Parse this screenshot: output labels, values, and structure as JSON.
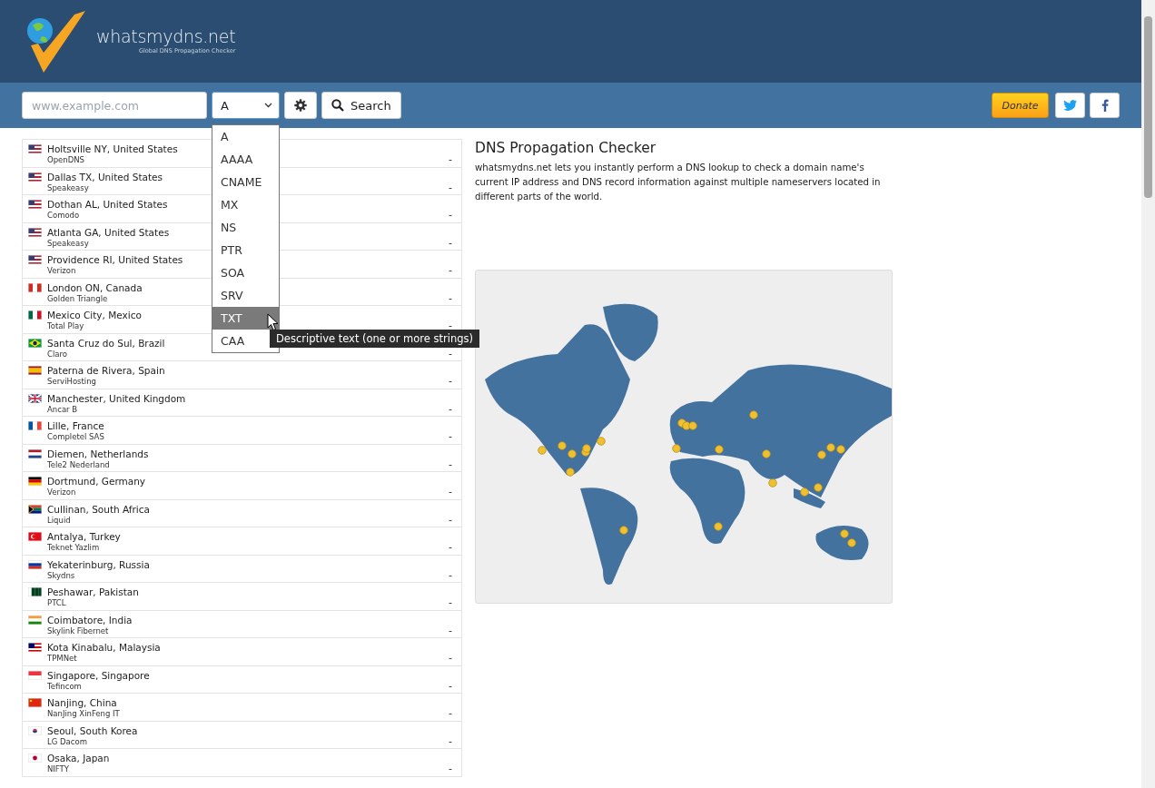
{
  "logo": {
    "name": "whatsmydns.net",
    "tagline": "Global DNS Propagation Checker"
  },
  "search": {
    "placeholder": "www.example.com",
    "record_type": "A",
    "button": "Search"
  },
  "record_menu": {
    "open": true,
    "options": [
      {
        "label": "A",
        "selected": false
      },
      {
        "label": "AAAA",
        "selected": false
      },
      {
        "label": "CNAME",
        "selected": false
      },
      {
        "label": "MX",
        "selected": false
      },
      {
        "label": "NS",
        "selected": false
      },
      {
        "label": "PTR",
        "selected": false
      },
      {
        "label": "SOA",
        "selected": false
      },
      {
        "label": "SRV",
        "selected": false
      },
      {
        "label": "TXT",
        "selected": true
      },
      {
        "label": "CAA",
        "selected": false
      }
    ],
    "tooltip": "Descriptive text (one or more strings)"
  },
  "donate": "Donate",
  "servers": [
    {
      "location": "Holtsville NY, United States",
      "provider": "OpenDNS",
      "result": "-",
      "kind": "us"
    },
    {
      "location": "Dallas TX, United States",
      "provider": "Speakeasy",
      "result": "-",
      "kind": "us"
    },
    {
      "location": "Dothan AL, United States",
      "provider": "Comodo",
      "result": "-",
      "kind": "us"
    },
    {
      "location": "Atlanta GA, United States",
      "provider": "Speakeasy",
      "result": "-",
      "kind": "us"
    },
    {
      "location": "Providence RI, United States",
      "provider": "Verizon",
      "result": "-",
      "kind": "us"
    },
    {
      "location": "London ON, Canada",
      "provider": "Golden Triangle",
      "result": "-",
      "kind": "ca"
    },
    {
      "location": "Mexico City, Mexico",
      "provider": "Total Play",
      "result": "-",
      "kind": "mx"
    },
    {
      "location": "Santa Cruz do Sul, Brazil",
      "provider": "Claro",
      "result": "-",
      "kind": "br"
    },
    {
      "location": "Paterna de Rivera, Spain",
      "provider": "ServiHosting",
      "result": "-",
      "kind": "es"
    },
    {
      "location": "Manchester, United Kingdom",
      "provider": "Ancar B",
      "result": "-",
      "kind": "gb"
    },
    {
      "location": "Lille, France",
      "provider": "Completel SAS",
      "result": "-",
      "kind": "fr"
    },
    {
      "location": "Diemen, Netherlands",
      "provider": "Tele2 Nederland",
      "result": "-",
      "kind": "nl"
    },
    {
      "location": "Dortmund, Germany",
      "provider": "Verizon",
      "result": "-",
      "kind": "de"
    },
    {
      "location": "Cullinan, South Africa",
      "provider": "Liquid",
      "result": "-",
      "kind": "za"
    },
    {
      "location": "Antalya, Turkey",
      "provider": "Teknet Yazlim",
      "result": "-",
      "kind": "tr"
    },
    {
      "location": "Yekaterinburg, Russia",
      "provider": "Skydns",
      "result": "-",
      "kind": "ru"
    },
    {
      "location": "Peshawar, Pakistan",
      "provider": "PTCL",
      "result": "-",
      "kind": "pk"
    },
    {
      "location": "Coimbatore, India",
      "provider": "Skylink Fibernet",
      "result": "-",
      "kind": "in"
    },
    {
      "location": "Kota Kinabalu, Malaysia",
      "provider": "TPMNet",
      "result": "-",
      "kind": "my"
    },
    {
      "location": "Singapore, Singapore",
      "provider": "Tefincom",
      "result": "-",
      "kind": "sg"
    },
    {
      "location": "Nanjing, China",
      "provider": "NanJing XinFeng IT",
      "result": "-",
      "kind": "cn"
    },
    {
      "location": "Seoul, South Korea",
      "provider": "LG Dacom",
      "result": "-",
      "kind": "kr"
    },
    {
      "location": "Osaka, Japan",
      "provider": "NIFTY",
      "result": "-",
      "kind": "jp"
    }
  ],
  "intro": {
    "title": "DNS Propagation Checker",
    "text": "whatsmydns.net lets you instantly perform a DNS lookup to check a domain name's current IP address and DNS record information against multiple nameservers located in different parts of the world."
  }
}
